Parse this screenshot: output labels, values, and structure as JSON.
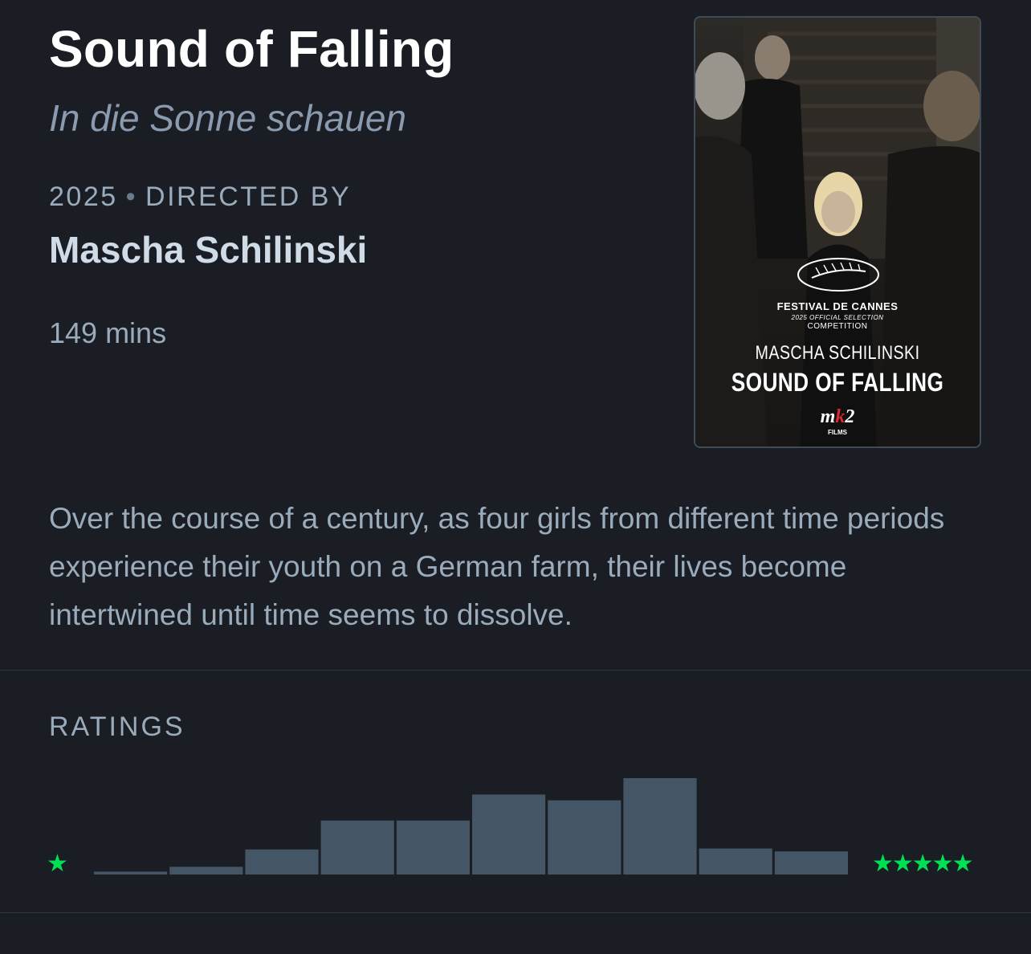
{
  "film": {
    "title": "Sound of Falling",
    "original_title": "In die Sonne schauen",
    "year": "2025",
    "separator": "•",
    "directed_by_label": "DIRECTED BY",
    "director": "Mascha Schilinski",
    "runtime": "149 mins",
    "synopsis": "Over the course of a century, as four girls from different time periods experience their youth on a German farm, their lives become intertwined until time seems to dissolve."
  },
  "poster": {
    "festival": "FESTIVAL DE CANNES",
    "selection": "2025 OFFICIAL SELECTION",
    "competition": "COMPETITION",
    "director": "MASCHA SCHILINSKI",
    "title": "SOUND OF FALLING",
    "distributor_logo_pre": "m",
    "distributor_logo_k": "k",
    "distributor_logo_post": "2",
    "distributor_sub": "FILMS"
  },
  "ratings": {
    "heading": "RATINGS",
    "low_star": "★",
    "high_stars": "★★★★★",
    "bar_color": "#445566",
    "star_color": "#00e054",
    "relative_counts": [
      0.03,
      0.08,
      0.26,
      0.56,
      0.56,
      0.83,
      0.77,
      1.0,
      0.27,
      0.24
    ]
  }
}
